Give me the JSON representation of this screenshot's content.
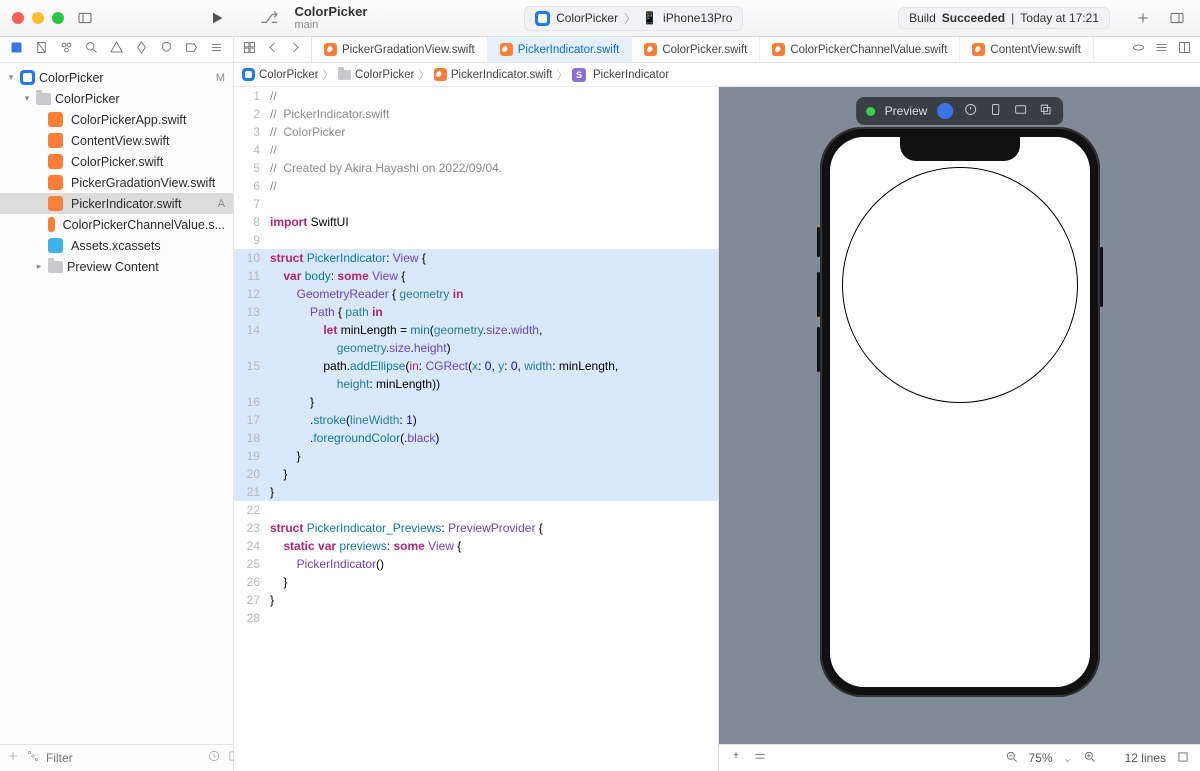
{
  "titlebar": {
    "project_name": "ColorPicker",
    "branch": "main",
    "scheme": "ColorPicker",
    "device": "iPhone13Pro",
    "status_prefix": "Build",
    "status_word": "Succeeded",
    "status_time": "Today at 17:21"
  },
  "tabs": [
    {
      "label": "PickerGradationView.swift",
      "active": false
    },
    {
      "label": "PickerIndicator.swift",
      "active": true
    },
    {
      "label": "ColorPicker.swift",
      "active": false
    },
    {
      "label": "ColorPickerChannelValue.swift",
      "active": false
    },
    {
      "label": "ContentView.swift",
      "active": false
    }
  ],
  "jumpbar": {
    "root": "ColorPicker",
    "folder": "ColorPicker",
    "file": "PickerIndicator.swift",
    "symbol": "PickerIndicator"
  },
  "navigator": {
    "root": {
      "name": "ColorPicker",
      "badge": "M"
    },
    "folder": "ColorPicker",
    "files": [
      {
        "name": "ColorPickerApp.swift",
        "badge": ""
      },
      {
        "name": "ContentView.swift",
        "badge": ""
      },
      {
        "name": "ColorPicker.swift",
        "badge": ""
      },
      {
        "name": "PickerGradationView.swift",
        "badge": ""
      },
      {
        "name": "PickerIndicator.swift",
        "badge": "A",
        "selected": true
      },
      {
        "name": "ColorPickerChannelValue.s...",
        "badge": ""
      }
    ],
    "assets": "Assets.xcassets",
    "preview": "Preview Content"
  },
  "filter_placeholder": "Filter",
  "code": {
    "lines": [
      {
        "n": 1,
        "hl": false,
        "segs": [
          {
            "t": "//",
            "c": "c-comment"
          }
        ]
      },
      {
        "n": 2,
        "hl": false,
        "segs": [
          {
            "t": "//  PickerIndicator.swift",
            "c": "c-comment"
          }
        ]
      },
      {
        "n": 3,
        "hl": false,
        "segs": [
          {
            "t": "//  ColorPicker",
            "c": "c-comment"
          }
        ]
      },
      {
        "n": 4,
        "hl": false,
        "segs": [
          {
            "t": "//",
            "c": "c-comment"
          }
        ]
      },
      {
        "n": 5,
        "hl": false,
        "segs": [
          {
            "t": "//  Created by Akira Hayashi on 2022/09/04.",
            "c": "c-comment"
          }
        ]
      },
      {
        "n": 6,
        "hl": false,
        "segs": [
          {
            "t": "//",
            "c": "c-comment"
          }
        ]
      },
      {
        "n": 7,
        "hl": false,
        "segs": [
          {
            "t": "",
            "c": ""
          }
        ]
      },
      {
        "n": 8,
        "hl": false,
        "segs": [
          {
            "t": "import",
            "c": "c-kw"
          },
          {
            "t": " SwiftUI",
            "c": ""
          }
        ]
      },
      {
        "n": 9,
        "hl": false,
        "segs": [
          {
            "t": "",
            "c": ""
          }
        ]
      },
      {
        "n": 10,
        "hl": true,
        "segs": [
          {
            "t": "struct",
            "c": "c-kw"
          },
          {
            "t": " ",
            "c": ""
          },
          {
            "t": "PickerIndicator",
            "c": "c-name"
          },
          {
            "t": ": ",
            "c": ""
          },
          {
            "t": "View",
            "c": "c-type"
          },
          {
            "t": " {",
            "c": ""
          }
        ]
      },
      {
        "n": 11,
        "hl": true,
        "segs": [
          {
            "t": "    ",
            "c": ""
          },
          {
            "t": "var",
            "c": "c-kw"
          },
          {
            "t": " ",
            "c": ""
          },
          {
            "t": "body",
            "c": "c-decl"
          },
          {
            "t": ": ",
            "c": ""
          },
          {
            "t": "some",
            "c": "c-kw"
          },
          {
            "t": " ",
            "c": ""
          },
          {
            "t": "View",
            "c": "c-type"
          },
          {
            "t": " {",
            "c": ""
          }
        ]
      },
      {
        "n": 12,
        "hl": true,
        "segs": [
          {
            "t": "        ",
            "c": ""
          },
          {
            "t": "GeometryReader",
            "c": "c-type"
          },
          {
            "t": " { ",
            "c": ""
          },
          {
            "t": "geometry",
            "c": "c-id"
          },
          {
            "t": " ",
            "c": ""
          },
          {
            "t": "in",
            "c": "c-kw"
          }
        ]
      },
      {
        "n": 13,
        "hl": true,
        "segs": [
          {
            "t": "            ",
            "c": ""
          },
          {
            "t": "Path",
            "c": "c-type"
          },
          {
            "t": " { ",
            "c": ""
          },
          {
            "t": "path",
            "c": "c-id"
          },
          {
            "t": " ",
            "c": ""
          },
          {
            "t": "in",
            "c": "c-kw"
          }
        ]
      },
      {
        "n": 14,
        "hl": true,
        "segs": [
          {
            "t": "                ",
            "c": ""
          },
          {
            "t": "let",
            "c": "c-kw"
          },
          {
            "t": " minLength = ",
            "c": ""
          },
          {
            "t": "min",
            "c": "c-func"
          },
          {
            "t": "(",
            "c": ""
          },
          {
            "t": "geometry",
            "c": "c-id"
          },
          {
            "t": ".",
            "c": ""
          },
          {
            "t": "size",
            "c": "c-prop"
          },
          {
            "t": ".",
            "c": ""
          },
          {
            "t": "width",
            "c": "c-prop"
          },
          {
            "t": ",",
            "c": ""
          }
        ]
      },
      {
        "n": "",
        "hl": true,
        "segs": [
          {
            "t": "                    ",
            "c": ""
          },
          {
            "t": "geometry",
            "c": "c-id"
          },
          {
            "t": ".",
            "c": ""
          },
          {
            "t": "size",
            "c": "c-prop"
          },
          {
            "t": ".",
            "c": ""
          },
          {
            "t": "height",
            "c": "c-prop"
          },
          {
            "t": ")",
            "c": ""
          }
        ]
      },
      {
        "n": 15,
        "hl": true,
        "segs": [
          {
            "t": "                path.",
            "c": ""
          },
          {
            "t": "addEllipse",
            "c": "c-func"
          },
          {
            "t": "(",
            "c": ""
          },
          {
            "t": "in",
            "c": "c-kw2"
          },
          {
            "t": ": ",
            "c": ""
          },
          {
            "t": "CGRect",
            "c": "c-type"
          },
          {
            "t": "(",
            "c": ""
          },
          {
            "t": "x",
            "c": "c-id"
          },
          {
            "t": ": ",
            "c": ""
          },
          {
            "t": "0",
            "c": "c-num"
          },
          {
            "t": ", ",
            "c": ""
          },
          {
            "t": "y",
            "c": "c-id"
          },
          {
            "t": ": ",
            "c": ""
          },
          {
            "t": "0",
            "c": "c-num"
          },
          {
            "t": ", ",
            "c": ""
          },
          {
            "t": "width",
            "c": "c-id"
          },
          {
            "t": ": minLength,",
            "c": ""
          }
        ]
      },
      {
        "n": "",
        "hl": true,
        "segs": [
          {
            "t": "                    ",
            "c": ""
          },
          {
            "t": "height",
            "c": "c-id"
          },
          {
            "t": ": minLength))",
            "c": ""
          }
        ]
      },
      {
        "n": 16,
        "hl": true,
        "segs": [
          {
            "t": "            }",
            "c": ""
          }
        ]
      },
      {
        "n": 17,
        "hl": true,
        "segs": [
          {
            "t": "            .",
            "c": ""
          },
          {
            "t": "stroke",
            "c": "c-func"
          },
          {
            "t": "(",
            "c": ""
          },
          {
            "t": "lineWidth",
            "c": "c-id"
          },
          {
            "t": ": ",
            "c": ""
          },
          {
            "t": "1",
            "c": "c-num"
          },
          {
            "t": ")",
            "c": ""
          }
        ]
      },
      {
        "n": 18,
        "hl": true,
        "segs": [
          {
            "t": "            .",
            "c": ""
          },
          {
            "t": "foregroundColor",
            "c": "c-func"
          },
          {
            "t": "(.",
            "c": ""
          },
          {
            "t": "black",
            "c": "c-prop"
          },
          {
            "t": ")",
            "c": ""
          }
        ]
      },
      {
        "n": 19,
        "hl": true,
        "segs": [
          {
            "t": "        }",
            "c": ""
          }
        ]
      },
      {
        "n": 20,
        "hl": true,
        "segs": [
          {
            "t": "    }",
            "c": ""
          }
        ]
      },
      {
        "n": 21,
        "hl": true,
        "segs": [
          {
            "t": "}",
            "c": ""
          }
        ]
      },
      {
        "n": 22,
        "hl": false,
        "segs": [
          {
            "t": "",
            "c": ""
          }
        ]
      },
      {
        "n": 23,
        "hl": false,
        "segs": [
          {
            "t": "struct",
            "c": "c-kw"
          },
          {
            "t": " ",
            "c": ""
          },
          {
            "t": "PickerIndicator_Previews",
            "c": "c-name"
          },
          {
            "t": ": ",
            "c": ""
          },
          {
            "t": "PreviewProvider",
            "c": "c-type"
          },
          {
            "t": " {",
            "c": ""
          }
        ]
      },
      {
        "n": 24,
        "hl": false,
        "segs": [
          {
            "t": "    ",
            "c": ""
          },
          {
            "t": "static",
            "c": "c-kw"
          },
          {
            "t": " ",
            "c": ""
          },
          {
            "t": "var",
            "c": "c-kw"
          },
          {
            "t": " ",
            "c": ""
          },
          {
            "t": "previews",
            "c": "c-decl"
          },
          {
            "t": ": ",
            "c": ""
          },
          {
            "t": "some",
            "c": "c-kw"
          },
          {
            "t": " ",
            "c": ""
          },
          {
            "t": "View",
            "c": "c-type"
          },
          {
            "t": " {",
            "c": ""
          }
        ]
      },
      {
        "n": 25,
        "hl": false,
        "segs": [
          {
            "t": "        ",
            "c": ""
          },
          {
            "t": "PickerIndicator",
            "c": "c-type"
          },
          {
            "t": "()",
            "c": ""
          }
        ]
      },
      {
        "n": 26,
        "hl": false,
        "segs": [
          {
            "t": "    }",
            "c": ""
          }
        ]
      },
      {
        "n": 27,
        "hl": false,
        "segs": [
          {
            "t": "}",
            "c": ""
          }
        ]
      },
      {
        "n": 28,
        "hl": false,
        "segs": [
          {
            "t": "",
            "c": ""
          }
        ]
      }
    ]
  },
  "preview": {
    "label": "Preview",
    "zoom": "75%",
    "linecount": "12 lines"
  }
}
